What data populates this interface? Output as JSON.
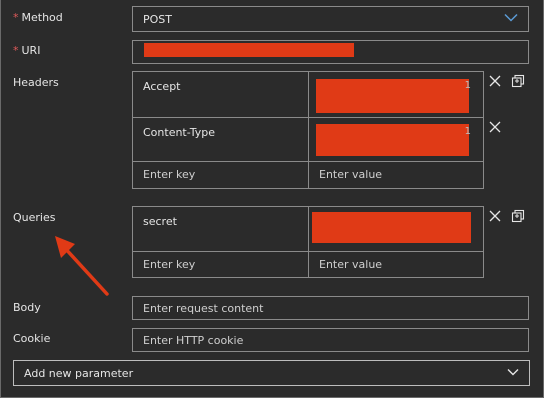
{
  "method": {
    "label": "Method",
    "required_mark": "*",
    "value": "POST"
  },
  "uri": {
    "label": "URI",
    "required_mark": "*",
    "value_redacted": true
  },
  "headers": {
    "label": "Headers",
    "rows": [
      {
        "key": "Accept",
        "value_redacted": true
      },
      {
        "key": "Content-Type",
        "value_redacted": true
      }
    ],
    "key_placeholder": "Enter key",
    "value_placeholder": "Enter value"
  },
  "queries": {
    "label": "Queries",
    "rows": [
      {
        "key": "secret",
        "value_redacted": true
      }
    ],
    "key_placeholder": "Enter key",
    "value_placeholder": "Enter value"
  },
  "body": {
    "label": "Body",
    "placeholder": "Enter request content"
  },
  "cookie": {
    "label": "Cookie",
    "placeholder": "Enter HTTP cookie"
  },
  "add_param": {
    "label": "Add new parameter"
  },
  "colors": {
    "redaction": "#e03a16",
    "arrow": "#e03a16",
    "chevron_accent": "#5b9bd5"
  },
  "icons": {
    "method_dropdown": "chevron-down-icon",
    "delete": "close-icon",
    "copy": "copy-icon",
    "add_param_dropdown": "chevron-down-icon",
    "annotation": "red-arrow"
  }
}
